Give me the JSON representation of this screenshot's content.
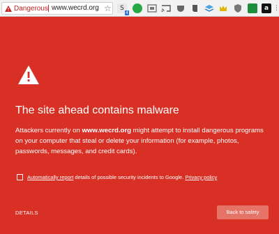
{
  "browser": {
    "security_chip": "Dangerous",
    "url": "www.wecrd.org",
    "extensions": [
      {
        "icon": "stumbleupon-like-icon",
        "badge": "4"
      },
      {
        "icon": "green-circle-icon"
      },
      {
        "icon": "drive-icon"
      },
      {
        "icon": "cast-icon"
      },
      {
        "icon": "pocket-like-icon"
      },
      {
        "icon": "evernote-icon"
      },
      {
        "icon": "layers-icon"
      },
      {
        "icon": "crown-icon"
      },
      {
        "icon": "shield-icon"
      },
      {
        "icon": "green-tile-icon"
      },
      {
        "icon": "amazon-icon"
      },
      {
        "icon": "menu-icon"
      }
    ]
  },
  "interstitial": {
    "headline": "The site ahead contains malware",
    "description_prefix": "Attackers currently on ",
    "description_site": "www.wecrd.org",
    "description_suffix": " might attempt to install dangerous programs on your computer that steal or delete your information (for example, photos, passwords, messages, and credit cards).",
    "report_link": "Automatically report",
    "report_text": " details of possible security incidents to Google. ",
    "privacy_link": "Privacy policy",
    "details_label": "DETAILS",
    "back_button": "Back to safety"
  },
  "colors": {
    "background": "#d93025",
    "button": "#e57368"
  }
}
